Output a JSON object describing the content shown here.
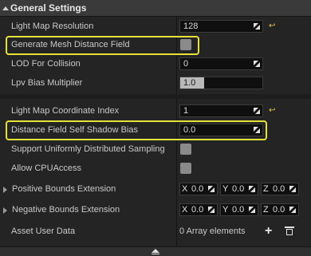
{
  "section": {
    "title": "General Settings"
  },
  "rows": {
    "light_map_resolution": {
      "label": "Light Map Resolution",
      "value": "128"
    },
    "generate_mesh_distance_field": {
      "label": "Generate Mesh Distance Field"
    },
    "lod_for_collision": {
      "label": "LOD For Collision",
      "value": "0"
    },
    "lpv_bias_multiplier": {
      "label": "Lpv Bias Multiplier",
      "value": "1.0"
    },
    "light_map_coordinate_index": {
      "label": "Light Map Coordinate Index",
      "value": "1"
    },
    "distance_field_self_shadow_bias": {
      "label": "Distance Field Self Shadow Bias",
      "value": "0.0"
    },
    "support_uniformly_distributed_sampling": {
      "label": "Support Uniformly Distributed Sampling"
    },
    "allow_cpu_access": {
      "label": "Allow CPUAccess"
    },
    "positive_bounds_extension": {
      "label": "Positive Bounds Extension",
      "x": "0.0",
      "y": "0.0",
      "z": "0.0"
    },
    "negative_bounds_extension": {
      "label": "Negative Bounds Extension",
      "x": "0.0",
      "y": "0.0",
      "z": "0.0"
    },
    "asset_user_data": {
      "label": "Asset User Data",
      "value": "0 Array elements"
    }
  },
  "axis_labels": {
    "x": "X",
    "y": "Y",
    "z": "Z"
  },
  "icons": {
    "reset": "reset-to-default-icon",
    "add": "plus-icon",
    "delete": "trash-icon",
    "collapse": "collapse-up-icon"
  },
  "colors": {
    "highlight": "#e6e23a",
    "reset_arrow": "#e0c44a"
  }
}
